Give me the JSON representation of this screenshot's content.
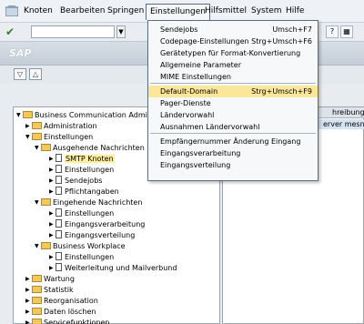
{
  "menubar": {
    "items": [
      "Knoten",
      "Bearbeiten",
      "Springen",
      "Einstellungen",
      "Hilfsmittel",
      "System",
      "Hilfe"
    ]
  },
  "titlebar": {
    "title": "SAP"
  },
  "dropdown": {
    "items": [
      {
        "label": "Sendejobs",
        "shortcut": "Umsch+F7"
      },
      {
        "label": "Codepage-Einstellungen",
        "shortcut": "Strg+Umsch+F6"
      },
      {
        "label": "Gerätetypen für Format-Konvertierung",
        "shortcut": ""
      },
      {
        "label": "Allgemeine Parameter",
        "shortcut": ""
      },
      {
        "label": "MIME Einstellungen",
        "shortcut": ""
      },
      {
        "label": "Default-Domain",
        "shortcut": "Strg+Umsch+F9"
      },
      {
        "label": "Pager-Dienste",
        "shortcut": ""
      },
      {
        "label": "Ländervorwahl",
        "shortcut": ""
      },
      {
        "label": "Ausnahmen Ländervorwahl",
        "shortcut": ""
      },
      {
        "label": "Empfängernummer Änderung Eingang",
        "shortcut": ""
      },
      {
        "label": "Eingangsverarbeitung",
        "shortcut": ""
      },
      {
        "label": "Eingangsverteilung",
        "shortcut": ""
      }
    ]
  },
  "tree": {
    "rows": [
      {
        "label": "Business Communication Administ",
        "level": 0,
        "type": "folder",
        "expanded": true
      },
      {
        "label": "Administration",
        "level": 1,
        "type": "folder",
        "expanded": false
      },
      {
        "label": "Einstellungen",
        "level": 1,
        "type": "folder",
        "expanded": true
      },
      {
        "label": "Ausgehende Nachrichten",
        "level": 2,
        "type": "folder",
        "expanded": true
      },
      {
        "label": "SMTP Knoten",
        "level": 3,
        "type": "doc",
        "highlight": true
      },
      {
        "label": "Einstellungen",
        "level": 3,
        "type": "doc"
      },
      {
        "label": "Sendejobs",
        "level": 3,
        "type": "doc"
      },
      {
        "label": "Pflichtangaben",
        "level": 3,
        "type": "doc"
      },
      {
        "label": "Eingehende Nachrichten",
        "level": 2,
        "type": "folder",
        "expanded": true
      },
      {
        "label": "Einstellungen",
        "level": 3,
        "type": "doc"
      },
      {
        "label": "Eingangsverarbeitung",
        "level": 3,
        "type": "doc"
      },
      {
        "label": "Eingangsverteilung",
        "level": 3,
        "type": "doc"
      },
      {
        "label": "Business Workplace",
        "level": 2,
        "type": "folder",
        "expanded": true
      },
      {
        "label": "Einstellungen",
        "level": 3,
        "type": "doc"
      },
      {
        "label": "Weiterleitung und Mailverbund",
        "level": 3,
        "type": "doc"
      },
      {
        "label": "Wartung",
        "level": 1,
        "type": "folder",
        "expanded": false
      },
      {
        "label": "Statistik",
        "level": 1,
        "type": "folder",
        "expanded": false
      },
      {
        "label": "Reorganisation",
        "level": 1,
        "type": "folder",
        "expanded": false
      },
      {
        "label": "Daten löschen",
        "level": 1,
        "type": "folder",
        "expanded": false
      },
      {
        "label": "Servicefunktionen",
        "level": 1,
        "type": "folder",
        "expanded": false
      }
    ]
  },
  "right_panel": {
    "header": "hreibung",
    "row_text": "erver mesn"
  }
}
